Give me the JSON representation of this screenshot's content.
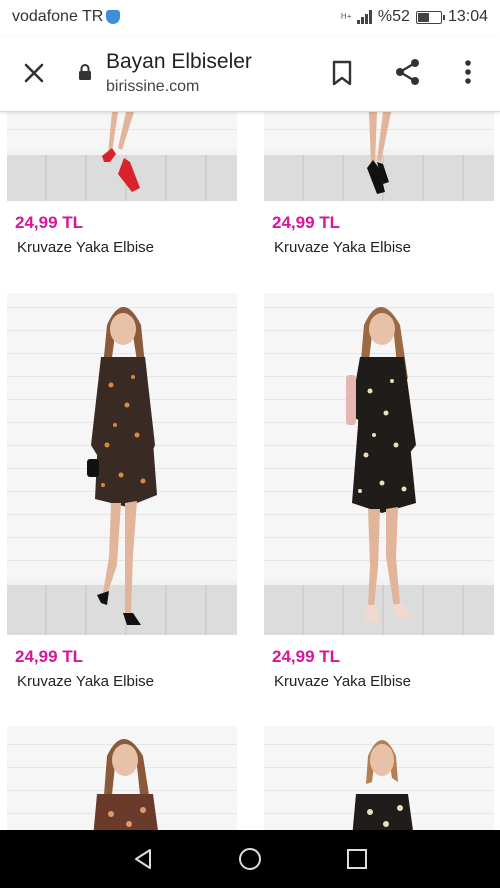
{
  "status_bar": {
    "carrier": "vodafone TR",
    "network": "H+",
    "battery_percent": "%52",
    "battery_level": 0.52,
    "time": "13:04"
  },
  "app_bar": {
    "title": "Bayan Elbiseler",
    "url": "birissine.com"
  },
  "products": [
    {
      "price": "24,99 TL",
      "name": "Kruvaze Yaka Elbise"
    },
    {
      "price": "24,99 TL",
      "name": "Kruvaze Yaka Elbise"
    },
    {
      "price": "24,99 TL",
      "name": "Kruvaze Yaka Elbise"
    },
    {
      "price": "24,99 TL",
      "name": "Kruvaze Yaka Elbise"
    }
  ],
  "colors": {
    "price": "#d9159b",
    "wall": "#f6f6f6",
    "dress_floral_dark": "#3a2a24",
    "shoe_red": "#d8232a",
    "shoe_black": "#111111",
    "shoe_nude": "#f1d9cf"
  },
  "icons": {
    "close": "close-icon",
    "lock": "lock-icon",
    "bookmark": "bookmark-icon",
    "share": "share-icon",
    "more": "more-vert-icon",
    "back": "nav-back-icon",
    "home": "nav-home-icon",
    "recents": "nav-recents-icon"
  }
}
